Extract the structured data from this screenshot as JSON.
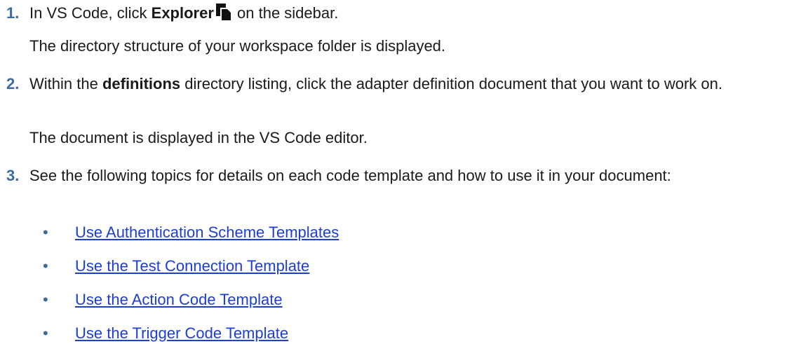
{
  "steps": [
    {
      "number": "1.",
      "text_before": "In VS Code, click ",
      "bold": "Explorer",
      "icon": "explorer-icon",
      "text_after": " on the sidebar.",
      "result": "The directory structure of your workspace folder is displayed."
    },
    {
      "number": "2.",
      "text_before": "Within the ",
      "bold": "definitions",
      "text_after": " directory listing, click the adapter definition document that you want to work on.",
      "result": "The document is displayed in the VS Code editor."
    },
    {
      "number": "3.",
      "text": "See the following topics for details on each code template and how to use it in your document:",
      "links": [
        "Use Authentication Scheme Templates",
        "Use the Test Connection Template",
        "Use the Action Code Template",
        "Use the Trigger Code Template"
      ]
    }
  ],
  "bullet_char": "•",
  "colors": {
    "step_number": "#3f6a9c",
    "link": "#1b3fd6",
    "text": "#1a1a1a"
  }
}
